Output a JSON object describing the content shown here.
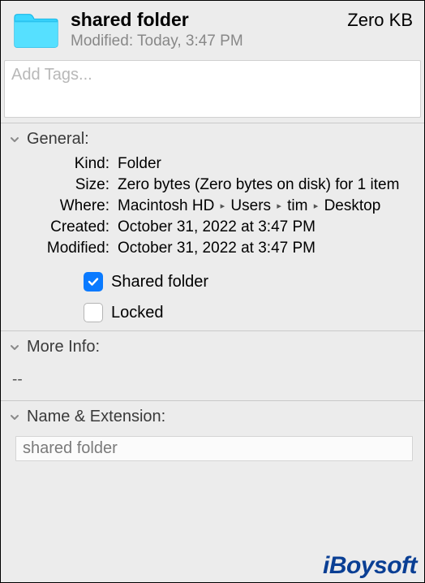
{
  "header": {
    "title": "shared folder",
    "size": "Zero KB",
    "modified_label": "Modified:",
    "modified_value": "Today, 3:47 PM"
  },
  "tags": {
    "placeholder": "Add Tags..."
  },
  "general": {
    "heading": "General:",
    "kind_label": "Kind:",
    "kind_value": "Folder",
    "size_label": "Size:",
    "size_value": "Zero bytes (Zero bytes on disk) for 1 item",
    "where_label": "Where:",
    "where_parts": [
      "Macintosh HD",
      "Users",
      "tim",
      "Desktop"
    ],
    "created_label": "Created:",
    "created_value": "October 31, 2022 at 3:47 PM",
    "modified_label": "Modified:",
    "modified_value": "October 31, 2022 at 3:47 PM",
    "shared_label": "Shared folder",
    "shared_checked": true,
    "locked_label": "Locked",
    "locked_checked": false
  },
  "moreinfo": {
    "heading": "More Info:",
    "content": "--"
  },
  "nameext": {
    "heading": "Name & Extension:",
    "value": "shared folder"
  },
  "watermark": "iBoysoft"
}
